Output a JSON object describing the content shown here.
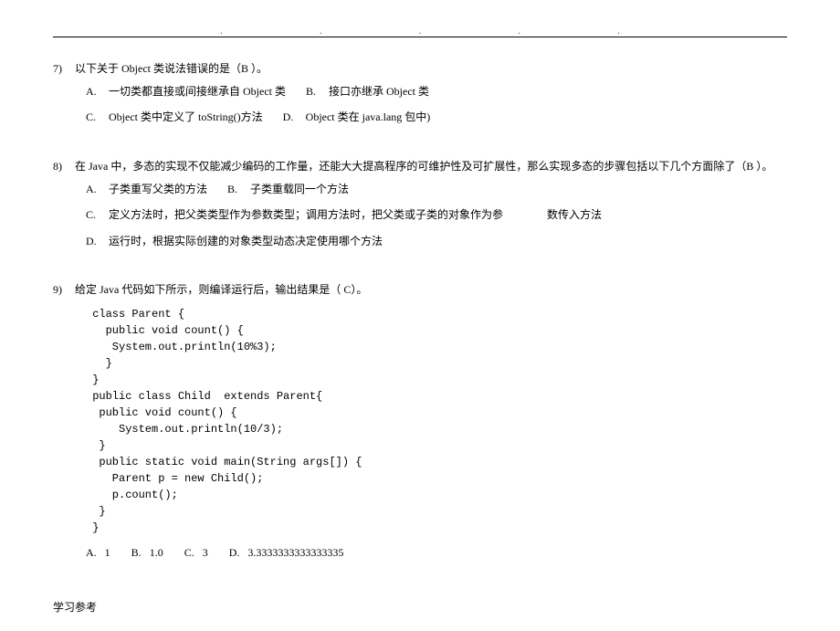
{
  "topDots": [
    ".",
    ".",
    ".",
    ".",
    "."
  ],
  "questions": [
    {
      "num": "7)",
      "text": "以下关于 Object 类说法错误的是（B  ）。",
      "optionLines": [
        [
          {
            "label": "A.",
            "text": "一切类都直接或间接继承自 Object 类"
          },
          {
            "label": "B.",
            "text": "接口亦继承 Object 类"
          }
        ],
        [
          {
            "label": "C.",
            "text": "Object 类中定义了 toString()方法"
          },
          {
            "label": "D.",
            "text": "Object 类在 java.lang 包中)"
          }
        ]
      ]
    },
    {
      "num": "8)",
      "text": "在 Java 中，多态的实现不仅能减少编码的工作量，还能大大提高程序的可维护性及可扩展性，那么实现多态的步骤包括以下几个方面除了（B  ）。",
      "optionLines": [
        [
          {
            "label": "A.",
            "text": "子类重写父类的方法"
          },
          {
            "label": "B.",
            "text": "子类重载同一个方法"
          }
        ],
        [
          {
            "label": "C.",
            "text": "定义方法时，把父类类型作为参数类型；调用方法时，把父类或子类的对象作为参",
            "trailing": "数传入方法"
          }
        ],
        [
          {
            "label": "D.",
            "text": "运行时，根据实际创建的对象类型动态决定使用哪个方法"
          }
        ]
      ]
    },
    {
      "num": "9)",
      "text": "给定 Java 代码如下所示，则编译运行后，输出结果是（ C）。",
      "code": " class Parent {\n   public void count() {\n    System.out.println(10%3);\n   }\n }\n public class Child  extends Parent{\n  public void count() {\n     System.out.println(10/3);\n  }\n  public static void main(String args[]) {\n    Parent p = new Child();\n    p.count();\n  }\n }",
      "answers": [
        {
          "label": "A.",
          "text": "1"
        },
        {
          "label": "B.",
          "text": "1.0"
        },
        {
          "label": "C.",
          "text": "3"
        },
        {
          "label": "D.",
          "text": "3.3333333333333335"
        }
      ]
    }
  ],
  "footer": "学习参考"
}
